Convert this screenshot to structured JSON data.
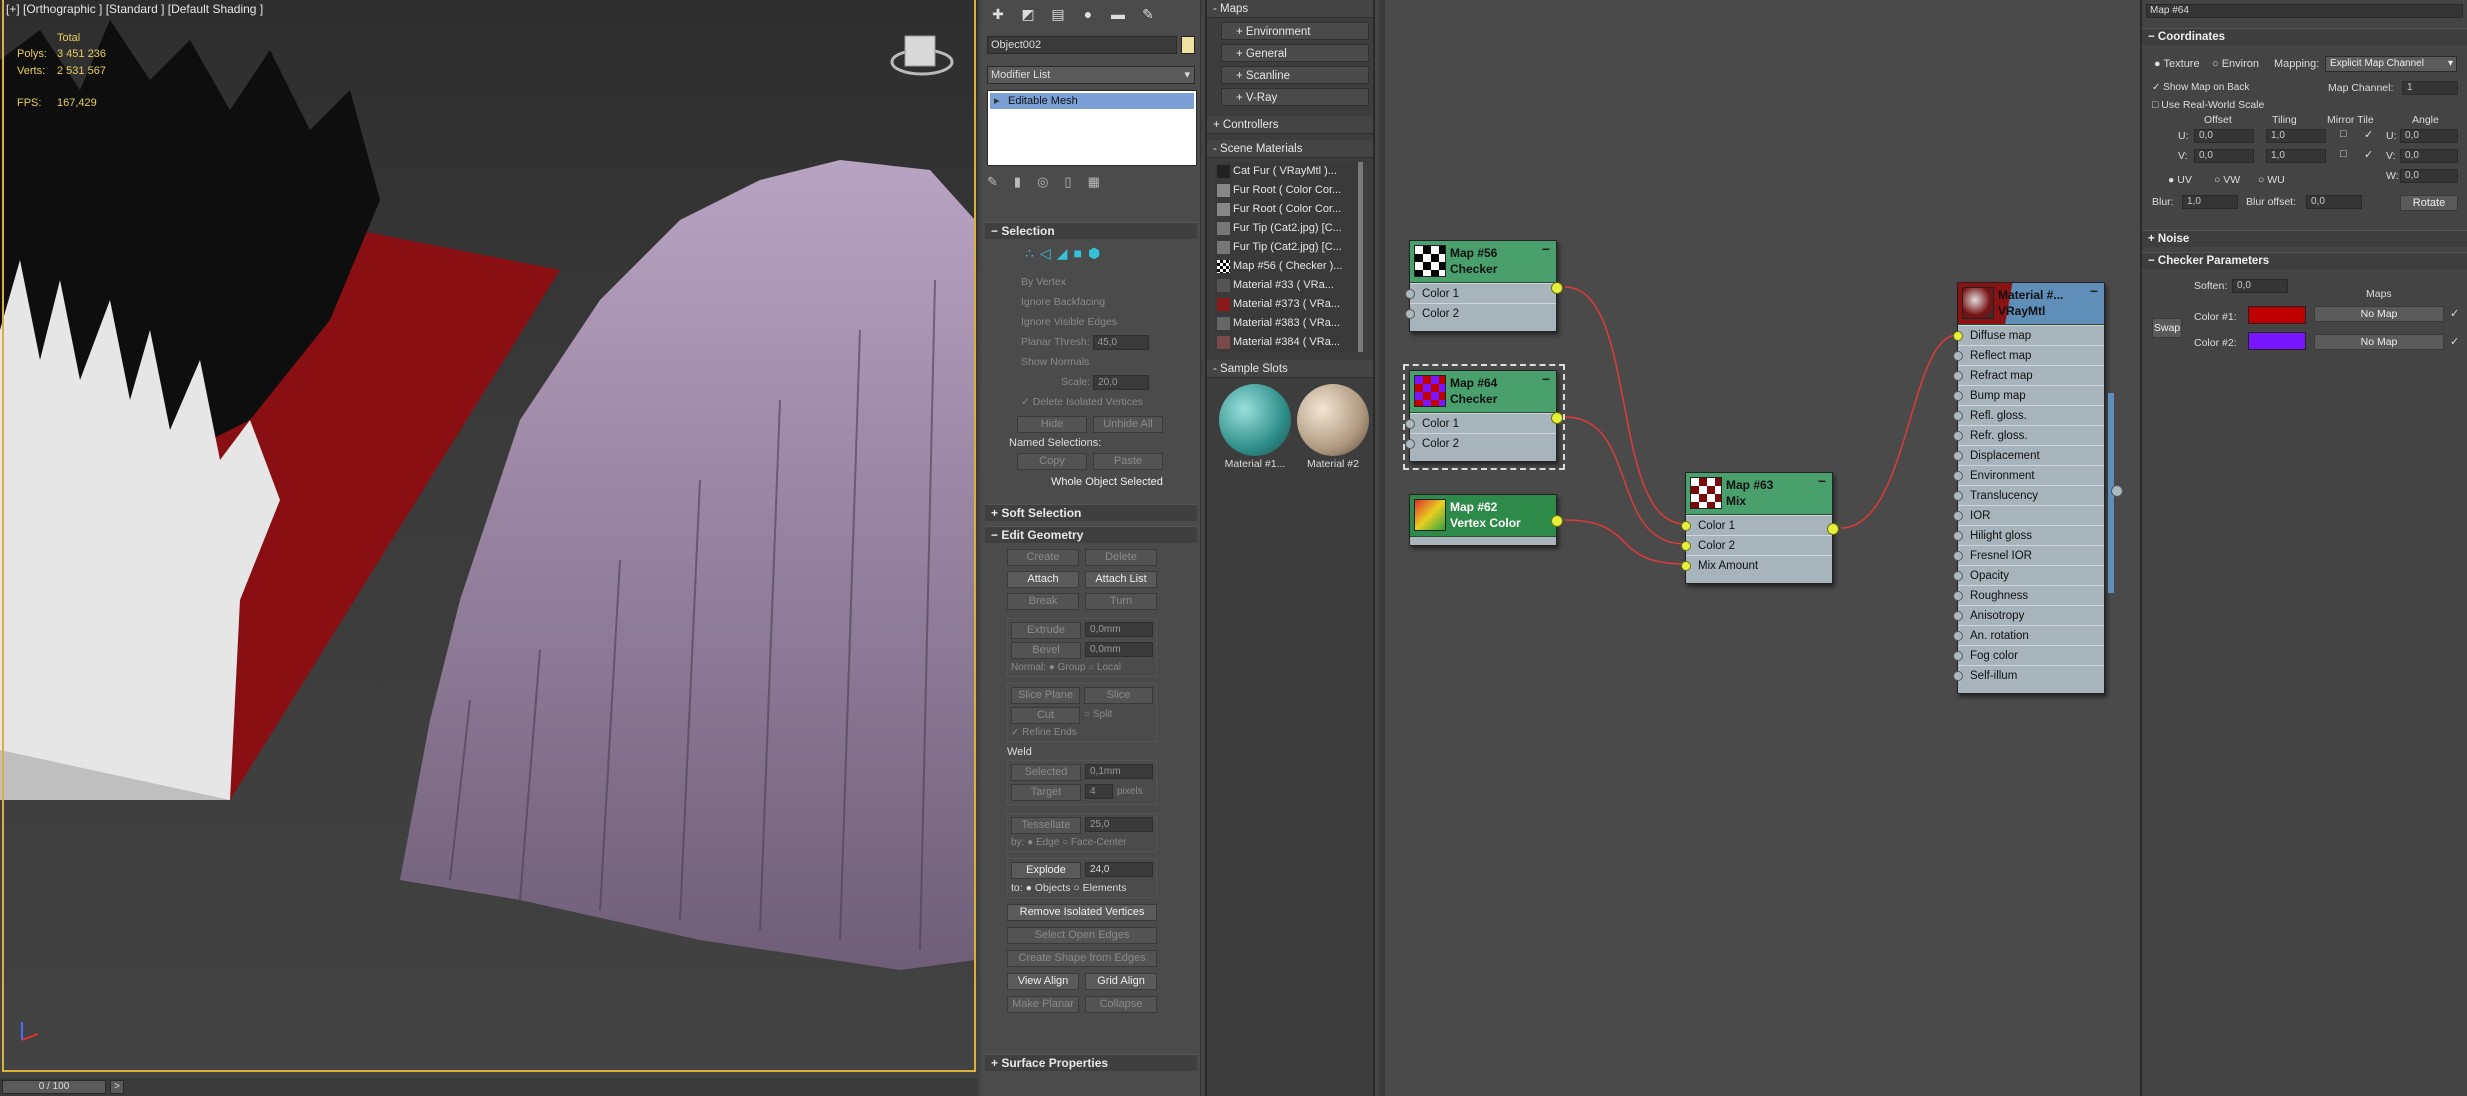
{
  "viewport": {
    "label": "[+] [Orthographic ] [Standard ] [Default Shading ]",
    "stats": {
      "total": "Total",
      "polys_label": "Polys:",
      "polys": "3 451 236",
      "verts_label": "Verts:",
      "verts": "2 531 567",
      "fps_label": "FPS:",
      "fps": "167,429"
    },
    "timeline": {
      "frame": "0 / 100",
      "next": ">"
    }
  },
  "command_panel": {
    "object_name": "Object002",
    "modifier_list": "Modifier List",
    "stack_item": "Editable Mesh",
    "selection": {
      "title": "Selection",
      "by_vertex": "By Vertex",
      "ignore_backfacing": "Ignore Backfacing",
      "ignore_visible_edges": "Ignore Visible Edges",
      "planar_thresh": "Planar Thresh:",
      "planar_val": "45,0",
      "show_normals": "Show Normals",
      "scale": "Scale:",
      "scale_val": "20,0",
      "delete_isolated": "Delete Isolated Vertices",
      "hide": "Hide",
      "unhide_all": "Unhide All",
      "named_selections": "Named Selections:",
      "copy": "Copy",
      "paste": "Paste",
      "status": "Whole Object Selected"
    },
    "soft_selection": "Soft Selection",
    "edit_geometry": {
      "title": "Edit Geometry",
      "create": "Create",
      "delete": "Delete",
      "attach": "Attach",
      "attach_list": "Attach List",
      "break": "Break",
      "turn": "Turn",
      "extrude": "Extrude",
      "extrude_val": "0,0mm",
      "bevel": "Bevel",
      "bevel_val": "0,0mm",
      "normal": "Normal:",
      "group": "Group",
      "local": "Local",
      "slice_plane": "Slice Plane",
      "slice": "Slice",
      "cut": "Cut",
      "split": "Split",
      "refine_ends": "Refine Ends",
      "weld": "Weld",
      "selected": "Selected",
      "selected_val": "0,1mm",
      "target": "Target",
      "target_val": "4",
      "pixels": "pixels",
      "tessellate": "Tessellate",
      "tess_val": "25,0",
      "by": "by:",
      "edge": "Edge",
      "face_center": "Face-Center",
      "explode": "Explode",
      "explode_val": "24,0",
      "to": "to:",
      "objects": "Objects",
      "elements": "Elements",
      "remove_isolated": "Remove Isolated Vertices",
      "select_open_edges": "Select Open Edges",
      "create_shape": "Create Shape from Edges",
      "view_align": "View Align",
      "grid_align": "Grid Align",
      "make_planar": "Make Planar",
      "collapse": "Collapse"
    },
    "surface_properties": "Surface Properties"
  },
  "material_browser": {
    "maps": "- Maps",
    "environment": "+ Environment",
    "general": "+ General",
    "scanline": "+ Scanline",
    "vray": "+ V-Ray",
    "controllers": "+ Controllers",
    "scene_materials": "- Scene Materials",
    "materials": [
      "Cat Fur  ( VRayMtl )...",
      "Fur Root  ( Color Cor...",
      "Fur Root  ( Color Cor...",
      "Fur Tip (Cat2.jpg)  [C...",
      "Fur Tip (Cat2.jpg)  [C...",
      "Map #56  ( Checker )...",
      "Material #33  ( VRa...",
      "Material #373  ( VRa...",
      "Material #383  ( VRa...",
      "Material #384  ( VRa..."
    ],
    "sample_slots": "- Sample Slots",
    "slots": [
      "Material #1...",
      "Material #2"
    ]
  },
  "nodes": {
    "n56": {
      "title": "Map #56",
      "type": "Checker",
      "slots": [
        "Color 1",
        "Color 2"
      ]
    },
    "n64": {
      "title": "Map #64",
      "type": "Checker",
      "slots": [
        "Color 1",
        "Color 2"
      ]
    },
    "n62": {
      "title": "Map #62",
      "type": "Vertex Color"
    },
    "n63": {
      "title": "Map #63",
      "type": "Mix",
      "slots": [
        "Color 1",
        "Color 2",
        "Mix Amount"
      ]
    },
    "nmat": {
      "title": "Material #...",
      "type": "VRayMtl",
      "slots": [
        "Diffuse map",
        "Reflect map",
        "Refract map",
        "Bump map",
        "Refl. gloss.",
        "Refr. gloss.",
        "Displacement",
        "Environment",
        "Translucency",
        "IOR",
        "Hilight gloss",
        "Fresnel IOR",
        "Opacity",
        "Roughness",
        "Anisotropy",
        "An. rotation",
        "Fog color",
        "Self-illum"
      ]
    }
  },
  "params": {
    "map_name": "Map #64",
    "coordinates": "Coordinates",
    "texture": "Texture",
    "environ": "Environ",
    "mapping": "Mapping:",
    "mapping_val": "Explicit Map Channel",
    "show_map_on_back": "Show Map on Back",
    "map_channel": "Map Channel:",
    "map_channel_val": "1",
    "use_real_world": "Use Real-World Scale",
    "offset": "Offset",
    "tiling": "Tiling",
    "mirror_tile": "Mirror Tile",
    "angle": "Angle",
    "u": "U:",
    "v": "V:",
    "w": "W:",
    "u_off": "0,0",
    "v_off": "0,0",
    "u_til": "1,0",
    "v_til": "1,0",
    "u_ang": "0,0",
    "v_ang": "0,0",
    "w_ang": "0,0",
    "uv": "UV",
    "vw": "VW",
    "wu": "WU",
    "blur": "Blur:",
    "blur_val": "1,0",
    "blur_offset": "Blur offset:",
    "blur_offset_val": "0,0",
    "rotate": "Rotate",
    "noise": "Noise",
    "checker_params": "Checker Parameters",
    "soften": "Soften:",
    "soften_val": "0,0",
    "maps": "Maps",
    "swap": "Swap",
    "color1": "Color #1:",
    "color2": "Color #2:",
    "no_map": "No Map",
    "color1_hex": "#c00000",
    "color2_hex": "#7a16ff"
  }
}
